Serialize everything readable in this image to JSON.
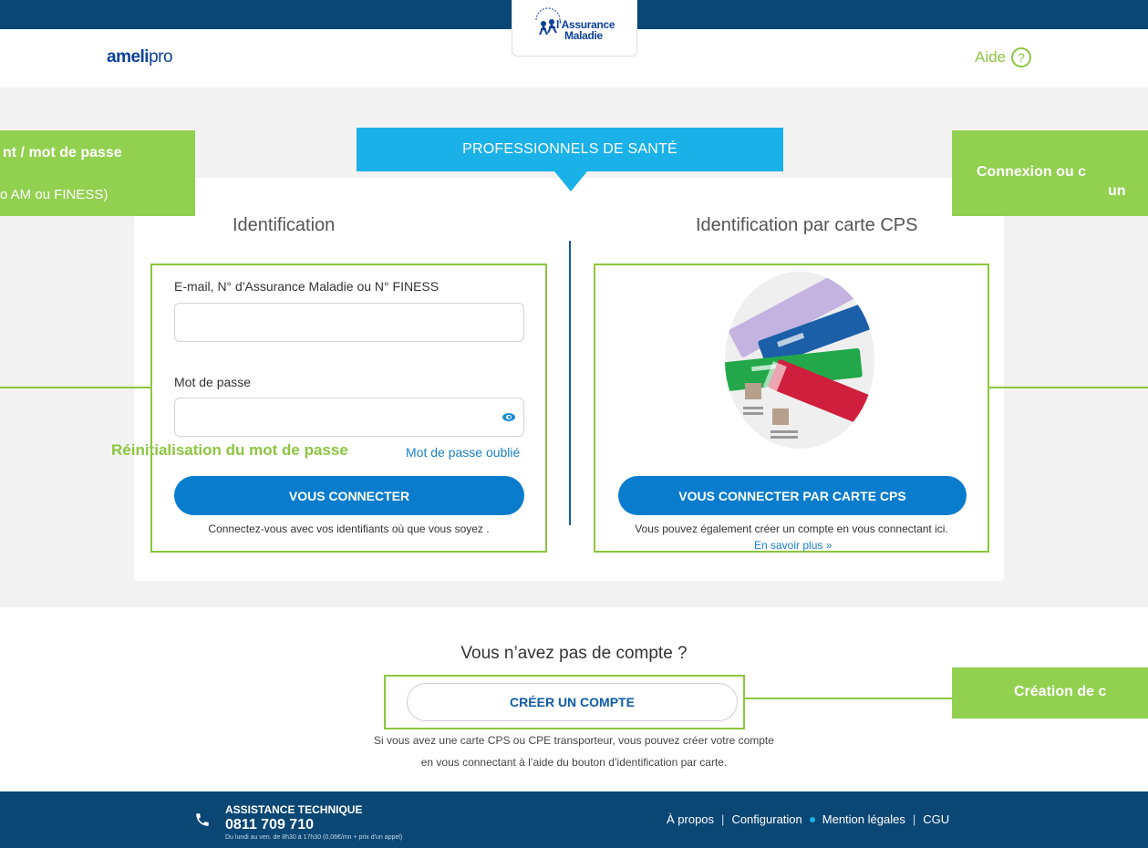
{
  "header": {
    "brand_main": "ameli",
    "brand_sub": "pro",
    "am_logo_line1": "l'Assurance",
    "am_logo_line2": "Maladie",
    "aide_label": "Aide",
    "aide_icon_glyph": "?"
  },
  "tab": {
    "label": "PROFESSIONNELS DE SANTÉ"
  },
  "left": {
    "title": "Identification",
    "email_label": "E-mail, N° d'Assurance Maladie ou N° FINESS",
    "email_value": "",
    "password_label": "Mot de passe",
    "password_value": "",
    "forgot_link": "Mot de passe oublié",
    "connect_button": "VOUS CONNECTER",
    "connect_note": "Connectez-vous avec vos identifiants où que vous soyez ."
  },
  "right": {
    "title": "Identification par carte CPS",
    "connect_button": "VOUS CONNECTER PAR CARTE CPS",
    "note": "Vous pouvez également créer un compte en vous connectant ici.",
    "more_link": "En savoir plus »"
  },
  "signup": {
    "question": "Vous n’avez pas de compte ?",
    "button": "CRÉER UN COMPTE",
    "note_line1": "Si vous avez une carte CPS ou CPE transporteur, vous pouvez créer votre compte",
    "note_line2": "en vous connectant à l’aide du bouton d’identification par carte."
  },
  "annotations": {
    "left_line1": "nt / mot de passe",
    "left_line2": "o AM ou FINESS)",
    "right_line1": "Connexion ou c",
    "right_line2": "un",
    "reset": "Réinitialisation du mot de passe",
    "create": "Création de c"
  },
  "footer": {
    "assist_title": "ASSISTANCE TECHNIQUE",
    "assist_number": "0811 709 710",
    "assist_hours": "Du lundi au ven. de 8h30 à 17h30 (0,06€/mn + prix d'un appel)",
    "links": [
      "À propos",
      "Configuration",
      "Mention légales",
      "CGU"
    ]
  },
  "colors": {
    "navy": "#0b4775",
    "accent_blue": "#1ab1e8",
    "button_blue": "#0a7ccd",
    "annotation_green": "#8cc63f"
  }
}
